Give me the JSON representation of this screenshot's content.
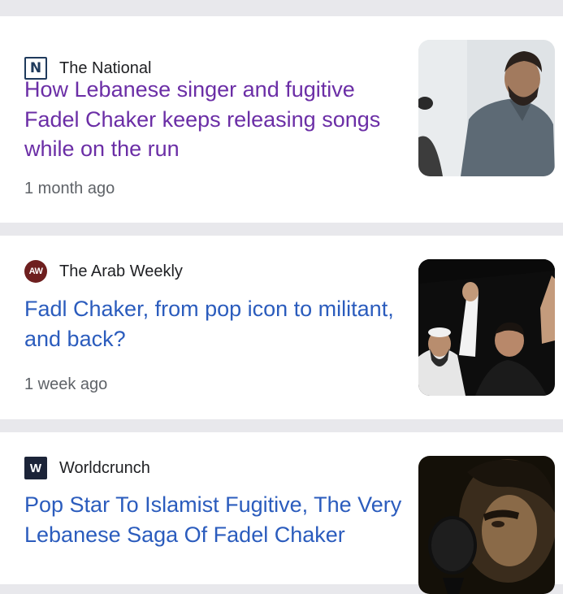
{
  "feed": {
    "articles": [
      {
        "source": "The National",
        "source_logo_text": "N",
        "headline": "How Lebanese singer and fugitive Fadel Chaker keeps releasing songs while on the run",
        "time": "1 month ago",
        "visited": true,
        "thumbnail": "photo-man-gray-shirt-singing"
      },
      {
        "source": "The Arab Weekly",
        "source_logo_text": "AW",
        "headline": "Fadl Chaker, from pop icon to militant, and back?",
        "time": "1 week ago",
        "visited": false,
        "thumbnail": "photo-two-men-raised-hands-night"
      },
      {
        "source": "Worldcrunch",
        "source_logo_text": "W",
        "headline": "Pop Star To Islamist Fugitive, The Very Lebanese Saga Of Fadel Chaker",
        "time": "",
        "visited": false,
        "thumbnail": "photo-singer-with-microphone-dark"
      }
    ]
  },
  "colors": {
    "visited_link": "#6b2ea6",
    "unvisited_link": "#2b5cbd",
    "separator": "#e8e8ec"
  }
}
